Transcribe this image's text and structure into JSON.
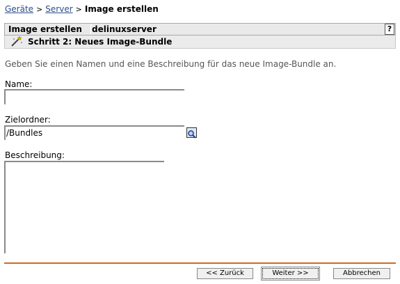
{
  "breadcrumb": {
    "items": [
      "Geräte",
      "Server"
    ],
    "current": "Image erstellen"
  },
  "header": {
    "title": "Image erstellen",
    "subject": "delinuxserver",
    "help_label": "?"
  },
  "step": {
    "title": "Schritt 2: Neues Image-Bundle",
    "icon": "wand-icon"
  },
  "intro": "Geben Sie einen Namen und eine Beschreibung für das neue Image-Bundle an.",
  "form": {
    "name_label": "Name:",
    "name_value": "",
    "folder_label": "Zielordner:",
    "folder_value": "/Bundles",
    "search_icon": "magnifier-icon",
    "description_label": "Beschreibung:",
    "description_value": ""
  },
  "colors": {
    "link": "#2b4d8c",
    "divider": "#d2691e"
  },
  "buttons": {
    "back": "<< Zurück",
    "next": "Weiter >>",
    "cancel": "Abbrechen"
  }
}
